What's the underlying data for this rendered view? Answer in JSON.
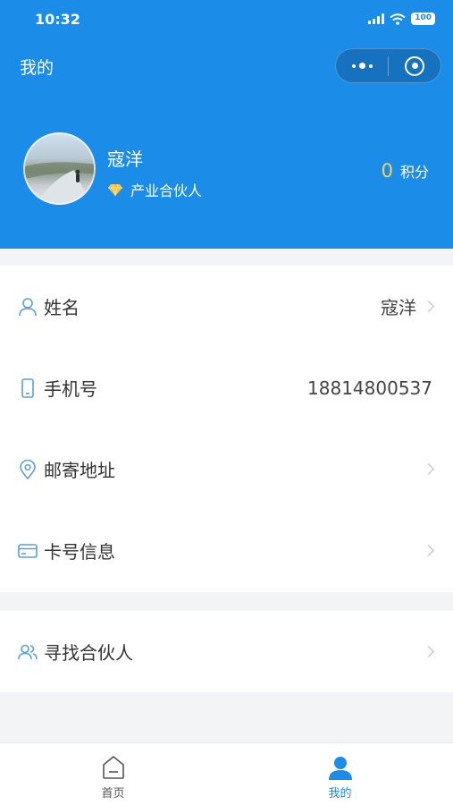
{
  "status_bar": {
    "time": "10:32",
    "battery": "100"
  },
  "header": {
    "title": "我的"
  },
  "profile": {
    "name": "寇洋",
    "role": "产业合伙人",
    "points_value": "0",
    "points_label": "积分"
  },
  "rows": {
    "name": {
      "label": "姓名",
      "value": "寇洋"
    },
    "phone": {
      "label": "手机号",
      "value": "18814800537"
    },
    "address": {
      "label": "邮寄地址"
    },
    "card": {
      "label": "卡号信息"
    },
    "partner": {
      "label": "寻找合伙人"
    }
  },
  "tabbar": {
    "home_label": "首页",
    "mine_label": "我的"
  },
  "colors": {
    "primary": "#1b8ce8",
    "points": "#f3d35b",
    "icon_blue": "#5a9fd6"
  }
}
